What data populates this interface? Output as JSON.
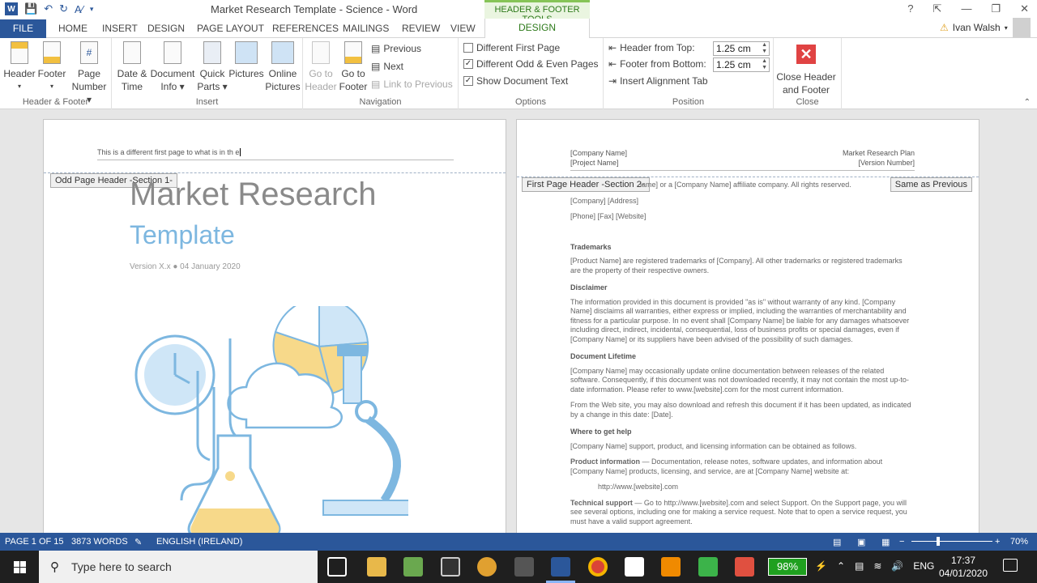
{
  "window": {
    "title": "Market Research Template - Science - Word",
    "contextual_tab_group": "HEADER & FOOTER TOOLS",
    "help": "?",
    "user": "Ivan Walsh"
  },
  "tabs": {
    "file": "FILE",
    "home": "HOME",
    "insert": "INSERT",
    "design": "DESIGN",
    "page_layout": "PAGE LAYOUT",
    "references": "REFERENCES",
    "mailings": "MAILINGS",
    "review": "REVIEW",
    "view": "VIEW",
    "hf_design": "DESIGN"
  },
  "ribbon": {
    "header_footer": {
      "label": "Header & Footer",
      "header": "Header",
      "footer": "Footer",
      "page_number_1": "Page",
      "page_number_2": "Number"
    },
    "insert": {
      "label": "Insert",
      "date_1": "Date &",
      "date_2": "Time",
      "docinfo_1": "Document",
      "docinfo_2": "Info",
      "quick_1": "Quick",
      "quick_2": "Parts",
      "pictures": "Pictures",
      "online_1": "Online",
      "online_2": "Pictures"
    },
    "navigation": {
      "label": "Navigation",
      "goto_header_1": "Go to",
      "goto_header_2": "Header",
      "goto_footer_1": "Go to",
      "goto_footer_2": "Footer",
      "previous": "Previous",
      "next": "Next",
      "link_previous": "Link to Previous"
    },
    "options": {
      "label": "Options",
      "different_first": "Different First Page",
      "different_odd_even": "Different Odd & Even Pages",
      "show_doc_text": "Show Document Text"
    },
    "position": {
      "label": "Position",
      "header_from_top": "Header from Top:",
      "header_value": "1.25 cm",
      "footer_from_bottom": "Footer from Bottom:",
      "footer_value": "1.25 cm",
      "insert_tab": "Insert Alignment Tab"
    },
    "close": {
      "label": "Close",
      "btn_1": "Close Header",
      "btn_2": "and Footer"
    }
  },
  "page1": {
    "header_text": "This is a different first page to what is in th e",
    "header_tag": "Odd Page Header -Section 1-",
    "title": "Market Research",
    "subtitle": "Template",
    "version": "Version X.x ● 04 January 2020"
  },
  "page2": {
    "header_left_1": "[Company Name]",
    "header_left_2": "[Project Name]",
    "header_right_1": "Market Research Plan",
    "header_right_2": "[Version Number]",
    "header_tag": "First Page Header -Section 2-",
    "same_as_previous": "Same as Previous",
    "copyright_line": "lame] or a [Company Name] affiliate company. All rights reserved.",
    "address": "[Company] [Address]",
    "contact": "[Phone] [Fax] [Website]",
    "trademarks_h": "Trademarks",
    "trademarks": "[Product Name] are registered trademarks of [Company]. All other trademarks or registered trademarks are the property of their respective owners.",
    "disclaimer_h": "Disclaimer",
    "disclaimer": "The information provided in this document is provided \"as is\" without warranty of any kind. [Company Name] disclaims all warranties, either express or implied, including the warranties of merchantability and fitness for a particular purpose. In no event shall [Company Name] be liable for any damages whatsoever including direct, indirect, incidental, consequential, loss of business profits or special damages, even if [Company Name] or its suppliers have been advised of the possibility of such damages.",
    "lifetime_h": "Document Lifetime",
    "lifetime_1": "[Company Name] may occasionally update online documentation between releases of the related software. Consequently, if this document was not downloaded recently, it may not contain the most up-to-date information. Please refer to www.[website].com for the most current information.",
    "lifetime_2": "From the Web site, you may also download and refresh this document if it has been updated, as indicated by a change in this date: [Date].",
    "help_h": "Where to get help",
    "help": "[Company Name] support, product, and licensing information can be obtained as follows.",
    "prodinfo_b": "Product information",
    "prodinfo": " — Documentation, release notes, software updates, and information about [Company Name] products, licensing, and service, are at [Company Name] website at:",
    "url": "http://www.[website].com",
    "tech_b": "Technical support",
    "tech": " — Go to http://www.[website].com and select Support. On the Support page, you will see several options, including one for making a service request. Note that to open a service request, you must have a valid support agreement."
  },
  "status": {
    "page": "PAGE 1 OF 15",
    "words": "3873 WORDS",
    "language": "ENGLISH (IRELAND)",
    "zoom": "70%",
    "zoom_minus": "−",
    "zoom_plus": "+"
  },
  "taskbar": {
    "search_placeholder": "Type here to search",
    "battery": "98%",
    "lang": "ENG",
    "time": "17:37",
    "date": "04/01/2020"
  },
  "colors": {
    "word_blue": "#2b579a",
    "contextual_green": "#86c457",
    "close_red": "#e04343",
    "art_blue": "#7db7e0",
    "art_yellow": "#f7d98a"
  }
}
